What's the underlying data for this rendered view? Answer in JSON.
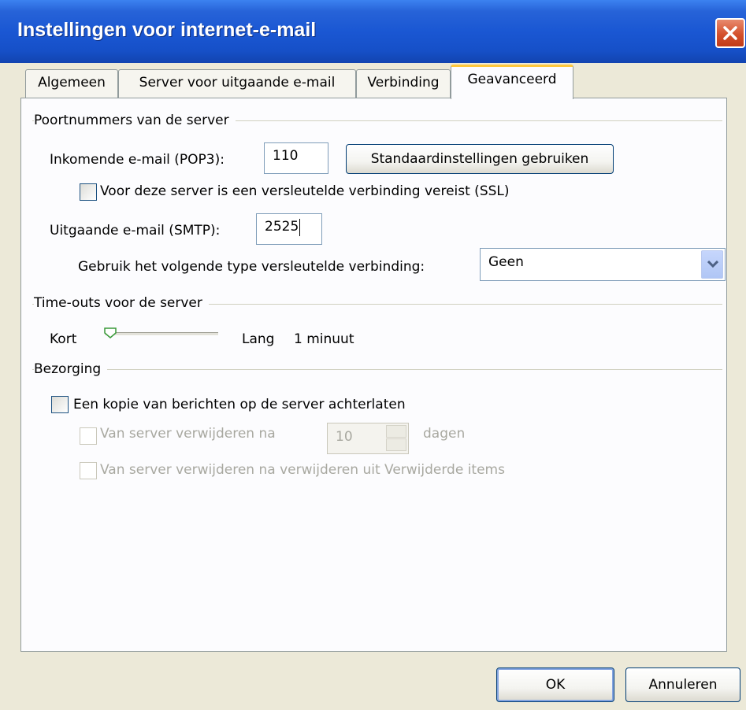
{
  "window": {
    "title": "Instellingen voor internet-e-mail"
  },
  "tabs": [
    {
      "label": "Algemeen"
    },
    {
      "label": "Server voor uitgaande e-mail"
    },
    {
      "label": "Verbinding"
    },
    {
      "label": "Geavanceerd",
      "active": true
    }
  ],
  "ports": {
    "group_label": "Poortnummers van de server",
    "incoming_label": "Inkomende e-mail (POP3):",
    "incoming_value": "110",
    "defaults_button": "Standaardinstellingen gebruiken",
    "ssl_label": "Voor deze server is een versleutelde verbinding vereist (SSL)",
    "ssl_checked": false,
    "outgoing_label": "Uitgaande e-mail (SMTP):",
    "outgoing_value": "2525",
    "encryption_label": "Gebruik het volgende type versleutelde verbinding:",
    "encryption_value": "Geen"
  },
  "timeouts": {
    "group_label": "Time-outs voor de server",
    "short_label": "Kort",
    "long_label": "Lang",
    "value_label": "1 minuut",
    "slider_value": 0
  },
  "delivery": {
    "group_label": "Bezorging",
    "keep_copy_label": "Een kopie van berichten op de server achterlaten",
    "keep_copy_checked": false,
    "remove_after_label": "Van server verwijderen na",
    "remove_after_days": "10",
    "days_label": "dagen",
    "remove_deleted_label": "Van server verwijderen na verwijderen uit Verwijderde items"
  },
  "buttons": {
    "ok": "OK",
    "cancel": "Annuleren"
  },
  "colors": {
    "titlebar": "#1a57d3",
    "close": "#d4502c",
    "dialog": "#ece9d8",
    "active_tab_accent": "#ffc83c"
  }
}
